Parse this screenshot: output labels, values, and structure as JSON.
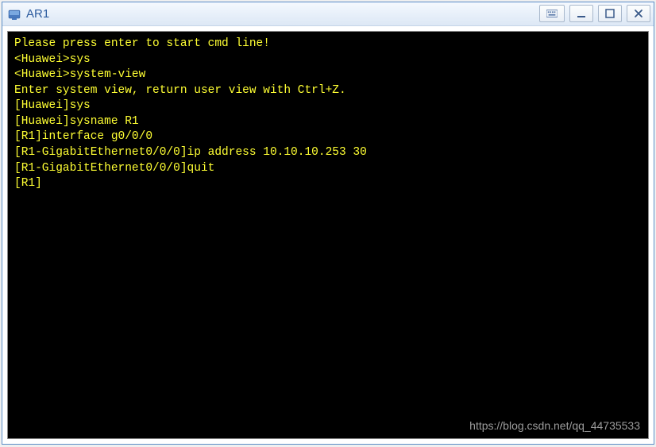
{
  "window": {
    "title": "AR1"
  },
  "terminal": {
    "lines": [
      "Please press enter to start cmd line!",
      "",
      "<Huawei>sys",
      "<Huawei>system-view",
      "Enter system view, return user view with Ctrl+Z.",
      "[Huawei]sys",
      "[Huawei]sysname R1",
      "[R1]interface g0/0/0",
      "[R1-GigabitEthernet0/0/0]ip address 10.10.10.253 30",
      "[R1-GigabitEthernet0/0/0]quit",
      "[R1]"
    ]
  },
  "watermark": "https://blog.csdn.net/qq_44735533"
}
